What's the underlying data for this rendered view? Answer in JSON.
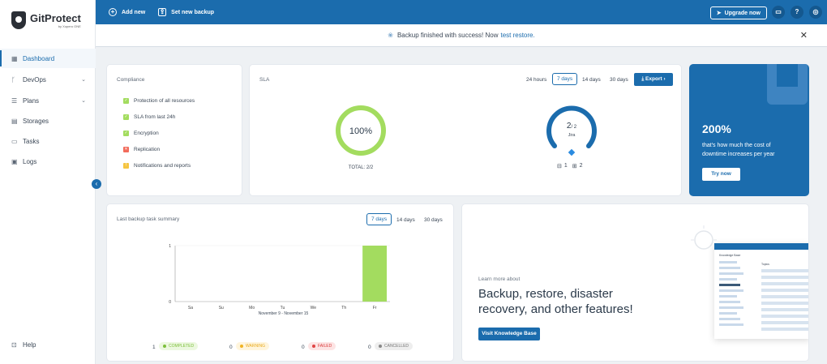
{
  "brand": {
    "name": "GitProtect",
    "sub": "by Xopero ONE"
  },
  "sidebar": {
    "items": [
      {
        "label": "Dashboard",
        "icon": "grid-icon"
      },
      {
        "label": "DevOps",
        "icon": "branch-icon"
      },
      {
        "label": "Plans",
        "icon": "list-icon"
      },
      {
        "label": "Storages",
        "icon": "database-icon"
      },
      {
        "label": "Tasks",
        "icon": "tasks-icon"
      },
      {
        "label": "Logs",
        "icon": "logs-icon"
      }
    ],
    "help": "Help"
  },
  "topbar": {
    "add_new": "Add new",
    "set_backup": "Set new backup",
    "upgrade": "Upgrade now"
  },
  "banner": {
    "text": "Backup finished with success! Now",
    "link": "test restore."
  },
  "compliance": {
    "title": "Compliance",
    "items": [
      {
        "label": "Protection of all resources",
        "state": "ok"
      },
      {
        "label": "SLA from last 24h",
        "state": "ok"
      },
      {
        "label": "Encryption",
        "state": "ok"
      },
      {
        "label": "Replication",
        "state": "fail"
      },
      {
        "label": "Notifications and reports",
        "state": "warn"
      }
    ]
  },
  "sla": {
    "title": "SLA",
    "ranges": [
      "24 hours",
      "7 days",
      "14 days",
      "30 days"
    ],
    "selected": "7 days",
    "export": "Export",
    "percent": "100%",
    "percent_value": 100,
    "total": "TOTAL: 2/2",
    "jira": {
      "value": "2",
      "of": "/ 2",
      "name": "Jira",
      "fraction": 1,
      "count_a": "1",
      "count_b": "2"
    }
  },
  "promo": {
    "big": "200%",
    "text": "that's how much the cost of downtime increases per year",
    "button": "Try now"
  },
  "summary": {
    "title": "Last backup task summary",
    "ranges": [
      "7 days",
      "14 days",
      "30 days"
    ],
    "selected": "7 days",
    "period": "November 9 - November 15",
    "stats": [
      {
        "count": "1",
        "label": "COMPLETED"
      },
      {
        "count": "0",
        "label": "WARNING"
      },
      {
        "count": "0",
        "label": "FAILED"
      },
      {
        "count": "0",
        "label": "CANCELLED"
      }
    ]
  },
  "chart_data": {
    "type": "bar",
    "categories": [
      "Sa",
      "Su",
      "Mo",
      "Tu",
      "We",
      "Th",
      "Fr"
    ],
    "values": [
      0,
      0,
      0,
      0,
      0,
      0,
      1
    ],
    "ylim": [
      0,
      1
    ],
    "yticks": [
      "0",
      "1"
    ],
    "xlabel": "November 9 - November 15",
    "color": "#a3dc5f"
  },
  "kb": {
    "small": "Learn more about",
    "headline": "Backup, restore, disaster recovery, and other features!",
    "button": "Visit Knowledge Base",
    "mock_left": "Knowledge Base",
    "mock_right": "Topics"
  },
  "colors": {
    "primary": "#1b6cad",
    "green": "#a3dc5f"
  }
}
